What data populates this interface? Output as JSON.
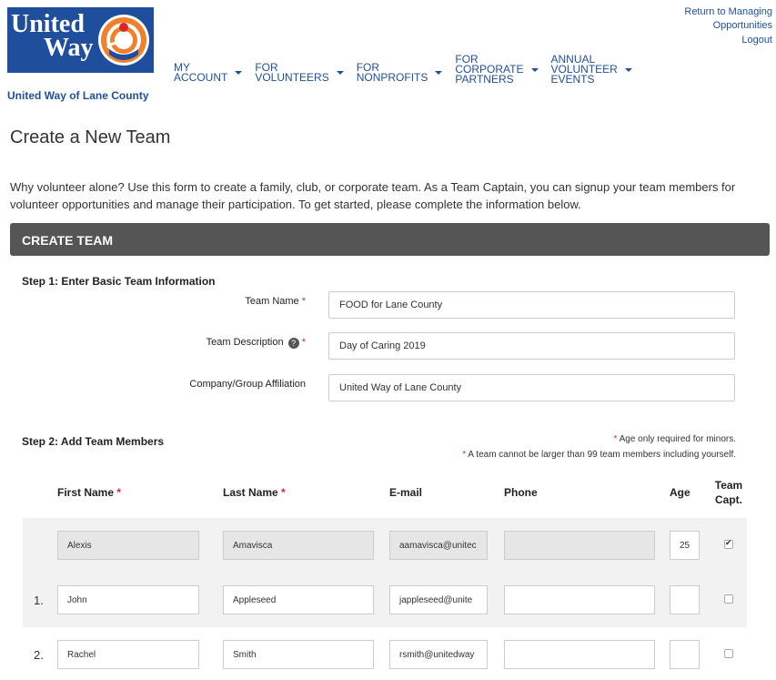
{
  "brand": {
    "logo_line1": "United",
    "logo_line2": "Way",
    "org_name": "United Way of Lane County"
  },
  "top_links": {
    "return_line1": "Return to Managing",
    "return_line2": "Opportunities",
    "logout": "Logout"
  },
  "nav": [
    {
      "label": "MY\nACCOUNT"
    },
    {
      "label": "FOR\nVOLUNTEERS"
    },
    {
      "label": "FOR\nNONPROFITS"
    },
    {
      "label": "FOR\nCORPORATE\nPARTNERS"
    },
    {
      "label": "ANNUAL\nVOLUNTEER\nEVENTS"
    }
  ],
  "page": {
    "title": "Create a New Team",
    "intro": "Why volunteer alone? Use this form to create a family, club, or corporate team. As a Team Captain, you can signup your team members for volunteer opportunities and manage their participation. To get started, please complete the information below.",
    "section_title": "CREATE TEAM"
  },
  "step1": {
    "title": "Step 1: Enter Basic Team Information",
    "team_name_label": "Team Name",
    "team_name_value": "FOOD for Lane County",
    "team_desc_label": "Team Description",
    "team_desc_help": "?",
    "team_desc_value": "Day of Caring 2019",
    "company_label": "Company/Group Affiliation",
    "company_value": "United Way of Lane County"
  },
  "step2": {
    "title": "Step 2: Add Team Members",
    "note_age": "Age only required for minors.",
    "note_size": "A team cannot be larger than 99 team members including yourself.",
    "columns": {
      "first": "First Name",
      "last": "Last Name",
      "email": "E-mail",
      "phone": "Phone",
      "age": "Age",
      "captain_line1": "Team",
      "captain_line2": "Capt."
    },
    "rows": [
      {
        "num": "",
        "first": "Alexis",
        "last": "Amavisca",
        "email": "aamavisca@unitec",
        "phone": "",
        "age": "25",
        "captain": true
      },
      {
        "num": "1.",
        "first": "John",
        "last": "Appleseed",
        "email": "jappleseed@unite",
        "phone": "",
        "age": "",
        "captain": false
      },
      {
        "num": "2.",
        "first": "Rachel",
        "last": "Smith",
        "email": "rsmith@unitedway",
        "phone": "",
        "age": "",
        "captain": false
      }
    ]
  },
  "colors": {
    "brand_blue": "#1f4f9c",
    "section_bar": "#555555",
    "required_red": "#d9262c"
  }
}
